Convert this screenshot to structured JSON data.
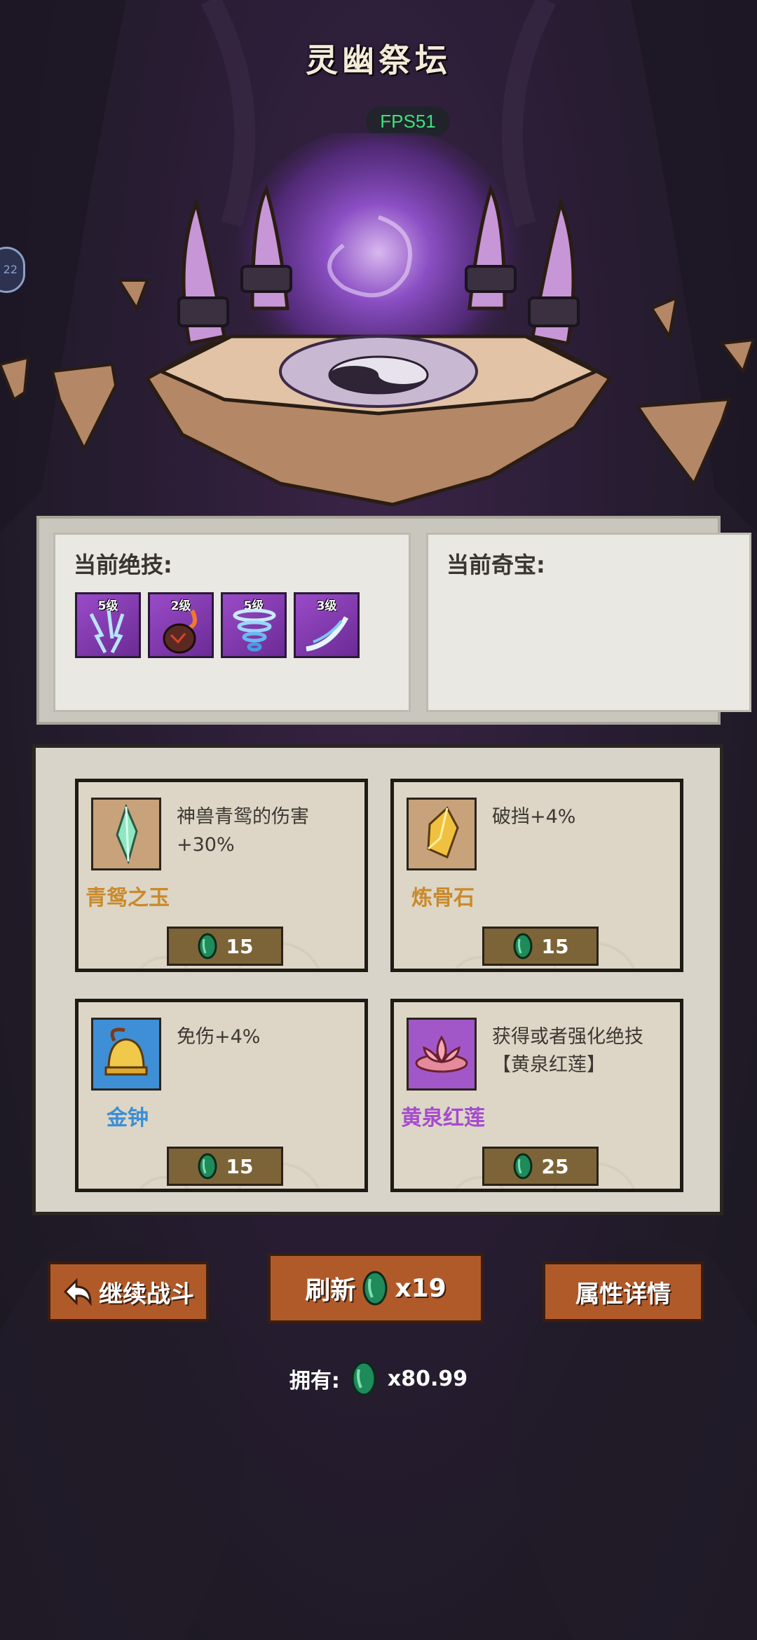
{
  "title": "灵幽祭坛",
  "fps": "FPS51",
  "side_tab": "22",
  "current_skills": {
    "label": "当前绝技:",
    "skills": [
      {
        "level": "5级",
        "icon": "lightning-rain-icon"
      },
      {
        "level": "2级",
        "icon": "meteor-icon"
      },
      {
        "level": "5级",
        "icon": "tornado-icon"
      },
      {
        "level": "3级",
        "icon": "wind-slash-icon"
      }
    ]
  },
  "current_treasure": {
    "label": "当前奇宝:"
  },
  "shop": {
    "items": [
      {
        "name": "青鸳之玉",
        "desc": "神兽青鸳的伤害+30%",
        "price": "15",
        "icon": "jade-crystal-icon",
        "name_color": "#c98a2b"
      },
      {
        "name": "炼骨石",
        "desc": "破挡+4%",
        "price": "15",
        "icon": "amber-stone-icon",
        "name_color": "#c98a2b"
      },
      {
        "name": "金钟",
        "desc": "免伤+4%",
        "price": "15",
        "icon": "golden-bell-icon",
        "name_color": "#3a8fd6"
      },
      {
        "name": "黄泉红莲",
        "desc": "获得或者强化绝技【黄泉红莲】",
        "price": "25",
        "icon": "red-lotus-icon",
        "name_color": "#a64bcf"
      }
    ]
  },
  "buttons": {
    "continue": "继续战斗",
    "refresh": "刷新",
    "refresh_cost": "x19",
    "attributes": "属性详情"
  },
  "owned": {
    "label": "拥有:",
    "amount": "x80.99"
  },
  "colors": {
    "gem": "#1f8a5a",
    "button": "#b05a2a",
    "price_bg": "#7d6438"
  }
}
